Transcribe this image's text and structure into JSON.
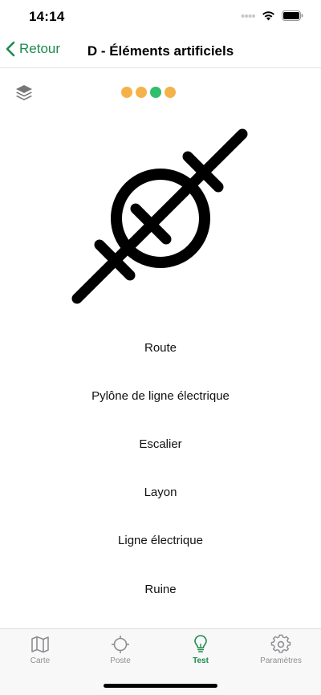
{
  "status_bar": {
    "time": "14:14"
  },
  "nav": {
    "back_label": "Retour",
    "title": "D - Éléments artificiels"
  },
  "progress_dots": [
    {
      "color": "#f6b24a"
    },
    {
      "color": "#f6b24a"
    },
    {
      "color": "#2fbe6a"
    },
    {
      "color": "#f6b24a"
    }
  ],
  "options": [
    "Route",
    "Pylône de ligne électrique",
    "Escalier",
    "Layon",
    "Ligne électrique",
    "Ruine"
  ],
  "tabs": [
    {
      "label": "Carte",
      "icon": "map-icon",
      "active": false
    },
    {
      "label": "Poste",
      "icon": "crosshair-icon",
      "active": false
    },
    {
      "label": "Test",
      "icon": "lightbulb-icon",
      "active": true
    },
    {
      "label": "Paramètres",
      "icon": "gear-icon",
      "active": false
    }
  ],
  "colors": {
    "accent": "#1d8a4d",
    "inactive": "#8e8e93"
  }
}
